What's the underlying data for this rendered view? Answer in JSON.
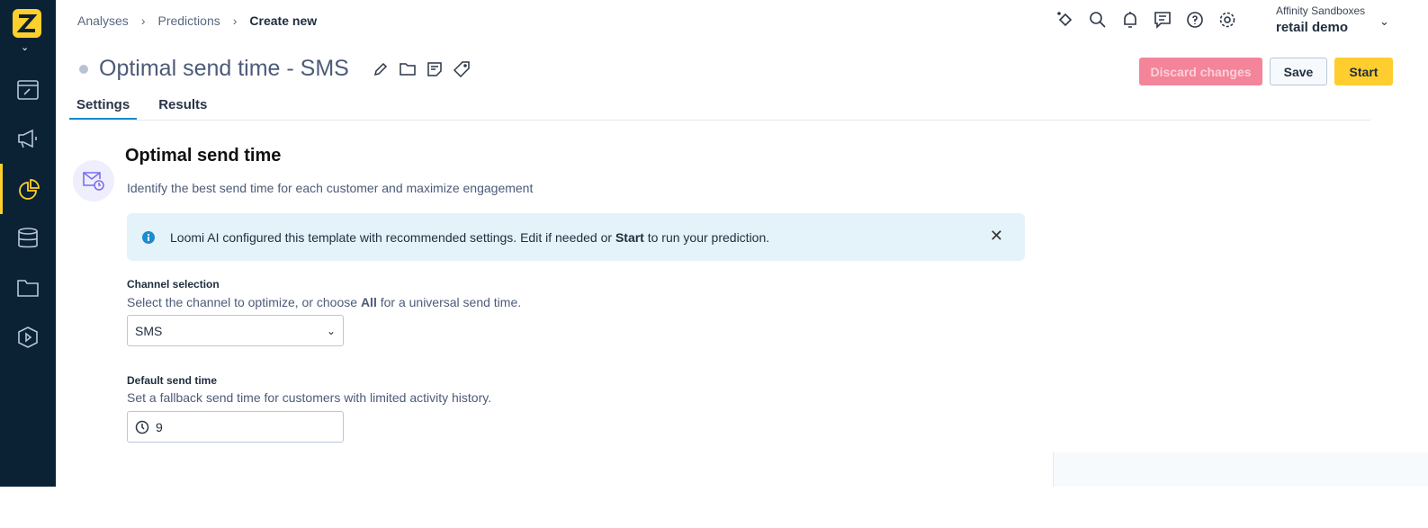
{
  "breadcrumb": [
    "Analyses",
    "Predictions",
    "Create new"
  ],
  "title": "Optimal send time - SMS",
  "tabs": [
    "Settings",
    "Results"
  ],
  "account": {
    "sandbox": "Affinity Sandboxes",
    "project": "retail demo"
  },
  "buttons": {
    "discard": "Discard changes",
    "save": "Save",
    "start": "Start"
  },
  "section": {
    "heading": "Optimal send time",
    "subtitle": "Identify the best send time for each customer and maximize engagement"
  },
  "info": {
    "pre": "Loomi AI configured this template with recommended settings. Edit if needed or ",
    "bold": "Start",
    "post": " to run your prediction."
  },
  "channel": {
    "label": "Channel selection",
    "desc_pre": "Select the channel to optimize, or choose ",
    "desc_bold": "All",
    "desc_post": " for a universal send time.",
    "value": "SMS"
  },
  "default_time": {
    "label": "Default send time",
    "desc": "Set a fallback send time for customers with limited activity history.",
    "value": "9"
  }
}
